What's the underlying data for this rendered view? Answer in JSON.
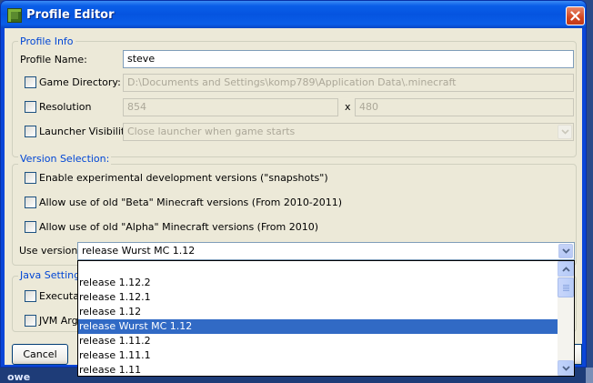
{
  "window": {
    "title": "Profile Editor"
  },
  "profile_info": {
    "legend": "Profile Info",
    "profile_name_label": "Profile Name:",
    "profile_name_value": "steve",
    "game_directory_label": "Game Directory:",
    "game_directory_value": "D:\\Documents and Settings\\komp789\\Application Data\\.minecraft",
    "resolution_label": "Resolution",
    "resolution_width": "854",
    "resolution_x": "x",
    "resolution_height": "480",
    "launcher_visibility_label": "Launcher Visibility",
    "launcher_visibility_value": "Close launcher when game starts"
  },
  "version_selection": {
    "legend": "Version Selection:",
    "snapshots_label": "Enable experimental development versions (\"snapshots\")",
    "beta_label": "Allow use of old \"Beta\" Minecraft versions (From 2010-2011)",
    "alpha_label": "Allow use of old \"Alpha\" Minecraft versions (From 2010)",
    "use_version_label": "Use version:",
    "use_version_value": "release Wurst MC 1.12",
    "options": [
      "release 1.12.2",
      "release 1.12.1",
      "release 1.12",
      "release Wurst MC 1.12",
      "release 1.11.2",
      "release 1.11.1",
      "release 1.11"
    ],
    "selected_option": "release Wurst MC 1.12"
  },
  "java_settings": {
    "legend": "Java Settings",
    "executable_label": "Executab",
    "jvm_arguments_label": "JVM Argu"
  },
  "buttons": {
    "cancel": "Cancel"
  },
  "desktop": {
    "text": "owe"
  },
  "colors": {
    "title_blue": "#0554e0",
    "legend_blue": "#0046d5",
    "selection_blue": "#316ac5",
    "close_red": "#d2461f",
    "dialog_bg": "#ece9d8"
  },
  "icons": [
    "minecraft-grass-icon",
    "close-icon",
    "chevron-down-icon",
    "scroll-up-icon",
    "scroll-down-icon"
  ]
}
